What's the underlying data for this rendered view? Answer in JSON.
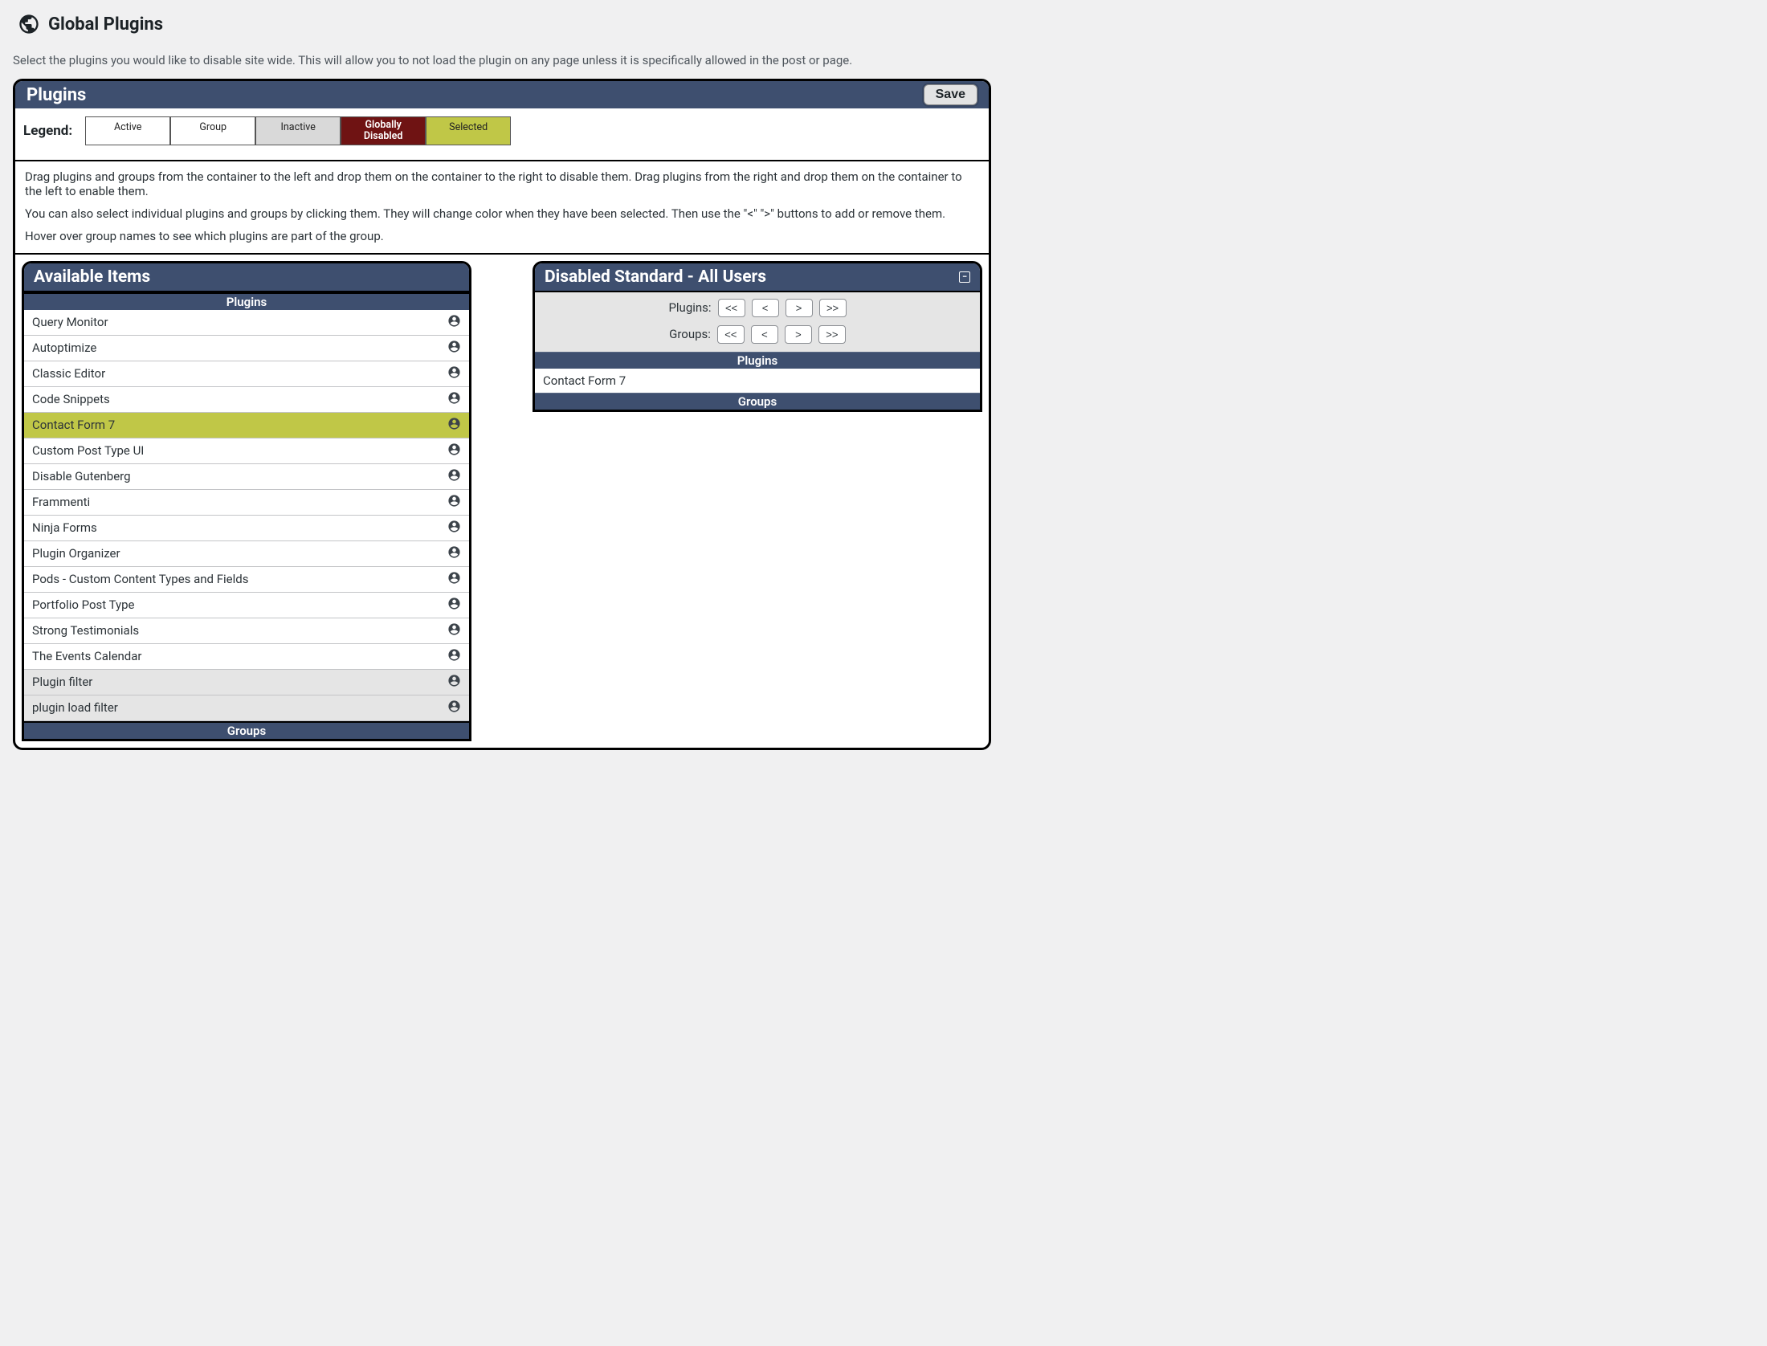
{
  "header": {
    "title": "Global Plugins",
    "intro": "Select the plugins you would like to disable site wide. This will allow you to not load the plugin on any page unless it is specifically allowed in the post or page."
  },
  "panel": {
    "title": "Plugins",
    "save_label": "Save",
    "legend_label": "Legend:",
    "legend": {
      "active": "Active",
      "group": "Group",
      "inactive": "Inactive",
      "disabled": "Globally Disabled",
      "selected": "Selected"
    },
    "instructions": {
      "p1": "Drag plugins and groups from the container to the left and drop them on the container to the right to disable them. Drag plugins from the right and drop them on the container to the left to enable them.",
      "p2": "You can also select individual plugins and groups by clicking them. They will change color when they have been selected. Then use the \"<\" \">\" buttons to add or remove them.",
      "p3": "Hover over group names to see which plugins are part of the group."
    }
  },
  "available": {
    "title": "Available Items",
    "plugins_heading": "Plugins",
    "groups_heading": "Groups",
    "items": [
      {
        "label": "Query Monitor",
        "state": "active"
      },
      {
        "label": "Autoptimize",
        "state": "active"
      },
      {
        "label": "Classic Editor",
        "state": "active"
      },
      {
        "label": "Code Snippets",
        "state": "active"
      },
      {
        "label": "Contact Form 7",
        "state": "selected"
      },
      {
        "label": "Custom Post Type UI",
        "state": "active"
      },
      {
        "label": "Disable Gutenberg",
        "state": "active"
      },
      {
        "label": "Frammenti",
        "state": "active"
      },
      {
        "label": "Ninja Forms",
        "state": "active"
      },
      {
        "label": "Plugin Organizer",
        "state": "active"
      },
      {
        "label": "Pods - Custom Content Types and Fields",
        "state": "active"
      },
      {
        "label": "Portfolio Post Type",
        "state": "active"
      },
      {
        "label": "Strong Testimonials",
        "state": "active"
      },
      {
        "label": "The Events Calendar",
        "state": "active"
      },
      {
        "label": "Plugin filter",
        "state": "inactive"
      },
      {
        "label": "plugin load filter",
        "state": "inactive"
      }
    ]
  },
  "disabled": {
    "title": "Disabled Standard - All Users",
    "plugins_label": "Plugins:",
    "groups_label": "Groups:",
    "btn_all_left": "<<",
    "btn_left": "<",
    "btn_right": ">",
    "btn_all_right": ">>",
    "plugins_heading": "Plugins",
    "groups_heading": "Groups",
    "items": [
      {
        "label": "Contact Form 7"
      }
    ]
  }
}
